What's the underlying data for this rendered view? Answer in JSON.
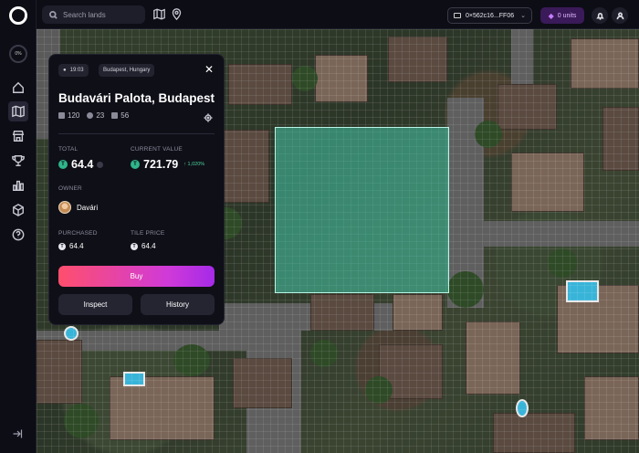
{
  "sidebar": {
    "progress": "0%",
    "items": [
      {
        "icon": "home-icon"
      },
      {
        "icon": "map-icon",
        "active": true
      },
      {
        "icon": "store-icon"
      },
      {
        "icon": "trophy-icon"
      },
      {
        "icon": "chart-icon"
      },
      {
        "icon": "cube-icon"
      },
      {
        "icon": "help-icon"
      }
    ]
  },
  "topbar": {
    "search_placeholder": "Search lands",
    "wallet_address": "0×562c16...FF06",
    "units_label": "0 units"
  },
  "panel": {
    "time": "19:03",
    "location": "Budapest, Hungary",
    "title": "Budavári Palota, Budapest",
    "stats": {
      "tiles": "120",
      "owners": "23",
      "blocks": "56"
    },
    "total_label": "TOTAL",
    "total_value": "64.4",
    "current_value_label": "CURRENT VALUE",
    "current_value": "721.79",
    "change": "↑ 1,020%",
    "owner_label": "OWNER",
    "owner_name": "Davári",
    "purchased_label": "PURCHASED",
    "purchased_value": "64.4",
    "tile_price_label": "TILE PRICE",
    "tile_price_value": "64.4",
    "token_symbol": "T",
    "buy_label": "Buy",
    "inspect_label": "Inspect",
    "history_label": "History"
  },
  "colors": {
    "accent_start": "#ff4f6d",
    "accent_end": "#a52ae8",
    "selection": "#46c8aa",
    "positive": "#4ad39a"
  }
}
